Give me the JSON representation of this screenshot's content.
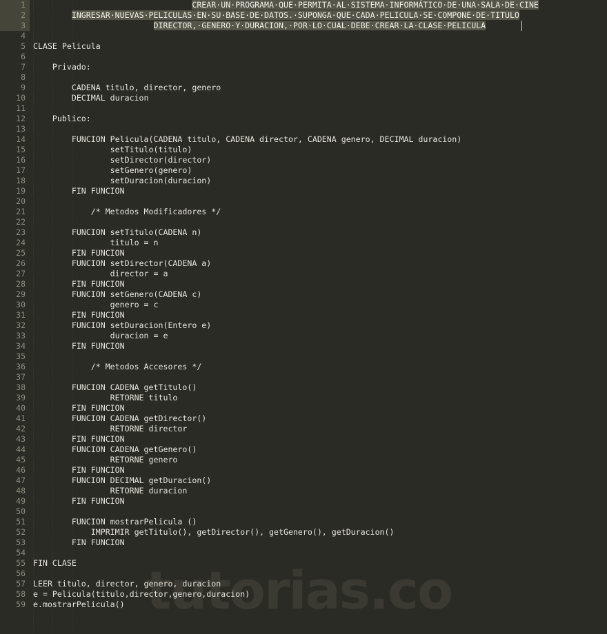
{
  "editor": {
    "app": "code-editor",
    "theme": "dark-olive",
    "background_color": "#2b2b26",
    "text_color": "#e6e6dd",
    "gutter_text_color": "#8e8e80",
    "selection_color": "#55554a",
    "gutter_selection_color": "#45453a",
    "watermark": "tutorias.co",
    "watermark_color": "#3a3a33",
    "whitespace_marker": "·",
    "total_lines": 59,
    "selected_lines": [
      1,
      2,
      3
    ],
    "font_size_px": 11.6,
    "line_height_px": 15,
    "indent_guide_columns": [
      0,
      4,
      8
    ]
  },
  "lines": [
    {
      "n": 1,
      "text": "                                 CREAR·UN·PROGRAMA·QUE·PERMITA·AL·SISTEMA·INFORMÁTICO·DE·UNA·SALA·DE·CINE",
      "selected": true
    },
    {
      "n": 2,
      "text": "        INGRESAR·NUEVAS·PELICULAS·EN·SU·BASE·DE·DATOS.·SUPONGA·QUE·CADA·PELICULA·SE·COMPONE·DE·TITULO",
      "selected": true
    },
    {
      "n": 3,
      "text": "                         DIRECTOR,·GENERO·Y·DURACION,·POR·LO·CUAL·DEBE·CREAR·LA·CLASE·PELICULA",
      "selected": true
    },
    {
      "n": 4,
      "text": "",
      "selected": false
    },
    {
      "n": 5,
      "text": "CLASE Pelicula",
      "selected": false
    },
    {
      "n": 6,
      "text": "",
      "selected": false
    },
    {
      "n": 7,
      "text": "    Privado:",
      "selected": false
    },
    {
      "n": 8,
      "text": "",
      "selected": false
    },
    {
      "n": 9,
      "text": "        CADENA titulo, director, genero",
      "selected": false
    },
    {
      "n": 10,
      "text": "        DECIMAL duracion",
      "selected": false
    },
    {
      "n": 11,
      "text": "",
      "selected": false
    },
    {
      "n": 12,
      "text": "    Publico:",
      "selected": false
    },
    {
      "n": 13,
      "text": "",
      "selected": false
    },
    {
      "n": 14,
      "text": "        FUNCION Pelicula(CADENA titulo, CADENA director, CADENA genero, DECIMAL duracion)",
      "selected": false
    },
    {
      "n": 15,
      "text": "                setTitulo(titulo)",
      "selected": false
    },
    {
      "n": 16,
      "text": "                setDirector(director)",
      "selected": false
    },
    {
      "n": 17,
      "text": "                setGenero(genero)",
      "selected": false
    },
    {
      "n": 18,
      "text": "                setDuracion(duracion)",
      "selected": false
    },
    {
      "n": 19,
      "text": "        FIN FUNCION",
      "selected": false
    },
    {
      "n": 20,
      "text": "",
      "selected": false
    },
    {
      "n": 21,
      "text": "            /* Metodos Modificadores */",
      "selected": false
    },
    {
      "n": 22,
      "text": "",
      "selected": false
    },
    {
      "n": 23,
      "text": "        FUNCION setTitulo(CADENA n)",
      "selected": false
    },
    {
      "n": 24,
      "text": "                titulo = n",
      "selected": false
    },
    {
      "n": 25,
      "text": "        FIN FUNCION",
      "selected": false
    },
    {
      "n": 26,
      "text": "        FUNCION setDirector(CADENA a)",
      "selected": false
    },
    {
      "n": 27,
      "text": "                director = a",
      "selected": false
    },
    {
      "n": 28,
      "text": "        FIN FUNCION",
      "selected": false
    },
    {
      "n": 29,
      "text": "        FUNCION setGenero(CADENA c)",
      "selected": false
    },
    {
      "n": 30,
      "text": "                genero = c",
      "selected": false
    },
    {
      "n": 31,
      "text": "        FIN FUNCION",
      "selected": false
    },
    {
      "n": 32,
      "text": "        FUNCION setDuracion(Entero e)",
      "selected": false
    },
    {
      "n": 33,
      "text": "                duracion = e",
      "selected": false
    },
    {
      "n": 34,
      "text": "        FIN FUNCION",
      "selected": false
    },
    {
      "n": 35,
      "text": "",
      "selected": false
    },
    {
      "n": 36,
      "text": "            /* Metodos Accesores */",
      "selected": false
    },
    {
      "n": 37,
      "text": "",
      "selected": false
    },
    {
      "n": 38,
      "text": "        FUNCION CADENA getTitulo()",
      "selected": false
    },
    {
      "n": 39,
      "text": "                RETORNE titulo",
      "selected": false
    },
    {
      "n": 40,
      "text": "        FIN FUNCION",
      "selected": false
    },
    {
      "n": 41,
      "text": "        FUNCION CADENA getDirector()",
      "selected": false
    },
    {
      "n": 42,
      "text": "                RETORNE director",
      "selected": false
    },
    {
      "n": 43,
      "text": "        FIN FUNCION",
      "selected": false
    },
    {
      "n": 44,
      "text": "        FUNCION CADENA getGenero()",
      "selected": false
    },
    {
      "n": 45,
      "text": "                RETORNE genero",
      "selected": false
    },
    {
      "n": 46,
      "text": "        FIN FUNCION",
      "selected": false
    },
    {
      "n": 47,
      "text": "        FUNCION DECIMAL getDuracion()",
      "selected": false
    },
    {
      "n": 48,
      "text": "                RETORNE duracion",
      "selected": false
    },
    {
      "n": 49,
      "text": "        FIN FUNCION",
      "selected": false
    },
    {
      "n": 50,
      "text": "",
      "selected": false
    },
    {
      "n": 51,
      "text": "        FUNCION mostrarPelicula ()",
      "selected": false
    },
    {
      "n": 52,
      "text": "            IMPRIMIR getTitulo(), getDirector(), getGenero(), getDuracion()",
      "selected": false
    },
    {
      "n": 53,
      "text": "        FIN FUNCION",
      "selected": false
    },
    {
      "n": 54,
      "text": "",
      "selected": false
    },
    {
      "n": 55,
      "text": "FIN CLASE",
      "selected": false
    },
    {
      "n": 56,
      "text": "",
      "selected": false
    },
    {
      "n": 57,
      "text": "LEER titulo, director, genero, duracion",
      "selected": false
    },
    {
      "n": 58,
      "text": "e = Pelicula(titulo,director,genero,duracion)",
      "selected": false
    },
    {
      "n": 59,
      "text": "e.mostrarPelicula()",
      "selected": false
    }
  ]
}
